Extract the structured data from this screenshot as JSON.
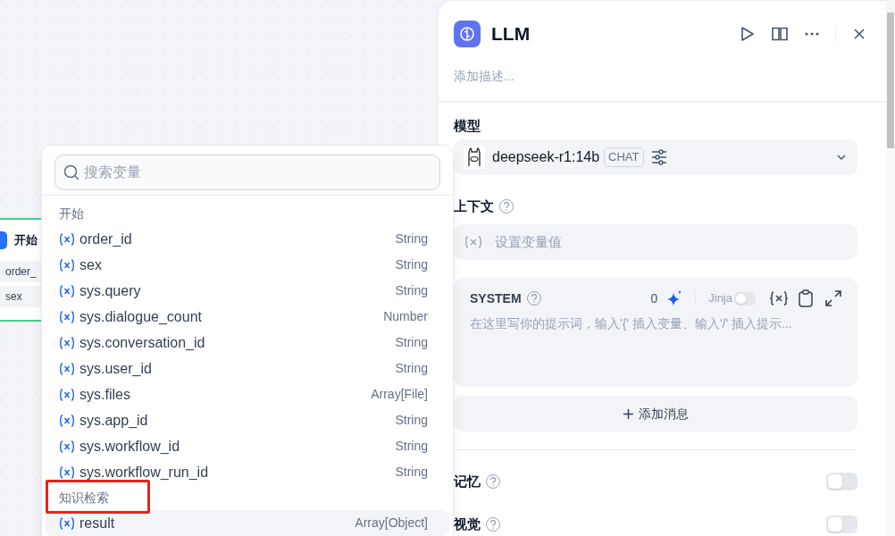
{
  "canvas": {
    "node": {
      "title": "开始",
      "fields": [
        "order_",
        "sex"
      ]
    }
  },
  "panel": {
    "title": "LLM",
    "description_placeholder": "添加描述...",
    "model": {
      "label": "模型",
      "name": "deepseek-r1:14b",
      "badge": "CHAT"
    },
    "context": {
      "label": "上下文",
      "placeholder": "设置变量值"
    },
    "system": {
      "label": "SYSTEM",
      "count": "0",
      "jinja": {
        "label": "Jinja",
        "on": false
      },
      "placeholder": "在这里写你的提示词，输入'{' 插入变量、输入'/' 插入提示..."
    },
    "add_message": "添加消息",
    "settings": [
      {
        "label": "记忆",
        "on": false
      },
      {
        "label": "视觉",
        "on": false
      }
    ]
  },
  "variable_picker": {
    "search_placeholder": "搜索变量",
    "groups": [
      {
        "title": "开始",
        "highlighted": false,
        "items": [
          {
            "name": "order_id",
            "type": "String",
            "selected": false
          },
          {
            "name": "sex",
            "type": "String",
            "selected": false
          },
          {
            "name": "sys.query",
            "type": "String",
            "selected": false
          },
          {
            "name": "sys.dialogue_count",
            "type": "Number",
            "selected": false
          },
          {
            "name": "sys.conversation_id",
            "type": "String",
            "selected": false
          },
          {
            "name": "sys.user_id",
            "type": "String",
            "selected": false
          },
          {
            "name": "sys.files",
            "type": "Array[File]",
            "selected": false
          },
          {
            "name": "sys.app_id",
            "type": "String",
            "selected": false
          },
          {
            "name": "sys.workflow_id",
            "type": "String",
            "selected": false
          },
          {
            "name": "sys.workflow_run_id",
            "type": "String",
            "selected": false
          }
        ]
      },
      {
        "title": "知识检索",
        "highlighted": true,
        "items": [
          {
            "name": "result",
            "type": "Array[Object]",
            "selected": true
          }
        ]
      }
    ]
  }
}
